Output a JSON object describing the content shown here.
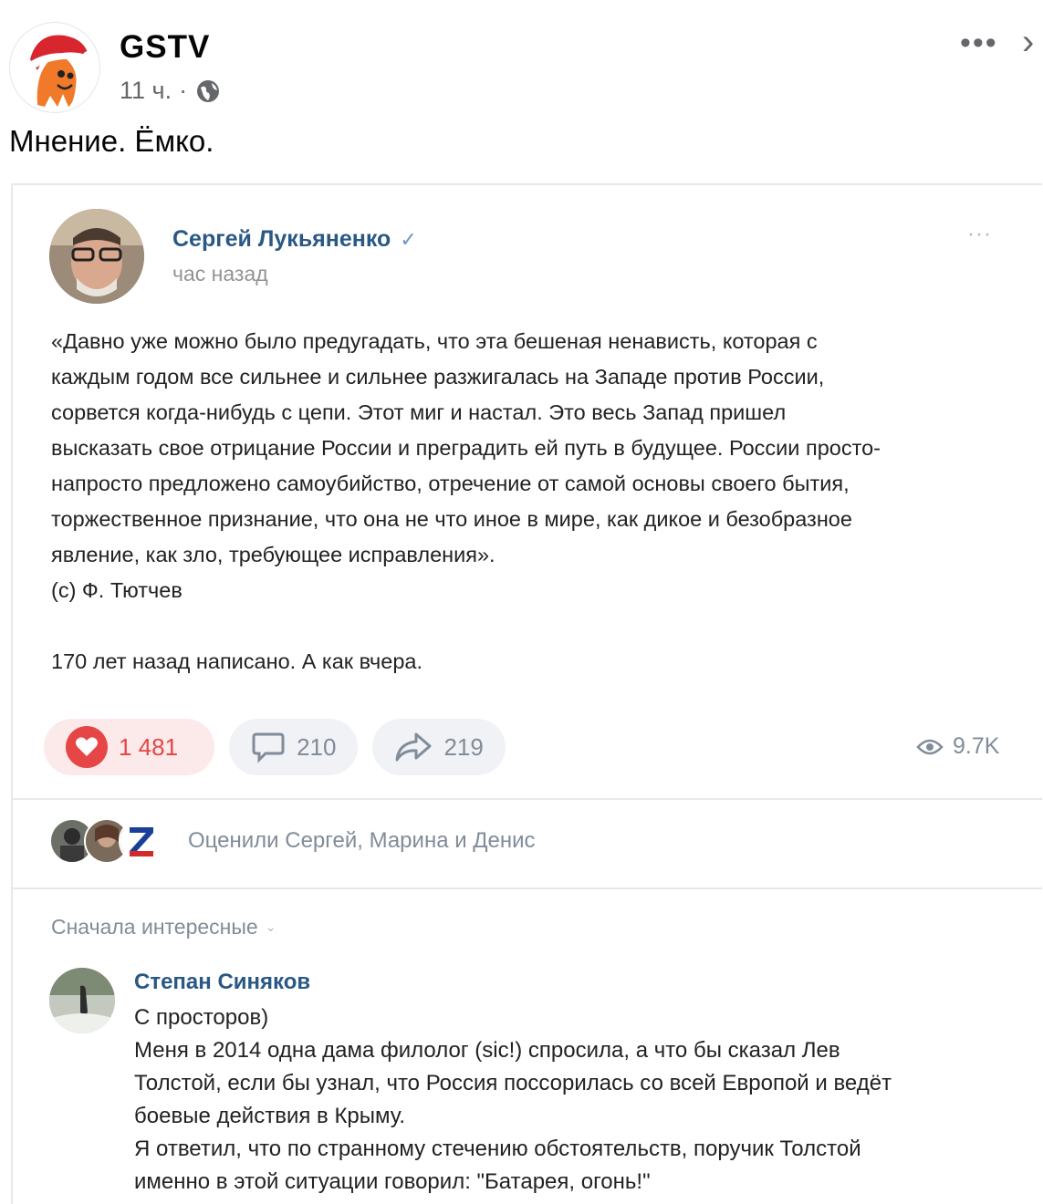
{
  "fb_post": {
    "page_name": "GSTV",
    "time": "11 ч.",
    "dot": "·",
    "caption": "Мнение. Ёмко."
  },
  "vk_post": {
    "author": "Сергей Лукьяненко",
    "verified_mark": "✓",
    "time": "час назад",
    "more": "···",
    "quote_lines": [
      "«Давно уже можно было предугадать, что эта бешеная ненависть, которая с",
      "каждым годом все сильнее и сильнее разжигалась на Западе против России,",
      "сорвется когда-нибудь с цепи. Этот миг и настал. Это весь Запад пришел",
      "высказать свое отрицание России и преградить ей путь в будущее. России просто-",
      "напросто предложено самоубийство, отречение от самой основы своего бытия,",
      "торжественное признание, что она не что иное в мире, как дикое и безобразное",
      "явление, как зло, требующее исправления».",
      "(с) Ф. Тютчев"
    ],
    "footer_line": "170 лет назад написано. А как вчера.",
    "likes": "1 481",
    "comments": "210",
    "shares": "219",
    "views": "9.7K",
    "liked_by": "Оценили Сергей, Марина и Денис",
    "sort_label": "Сначала интересные",
    "comment": {
      "author": "Степан Синяков",
      "lines": [
        "С просторов)",
        "Меня в 2014 одна дама филолог (sic!) спросила, а что бы сказал Лев",
        "Толстой, если бы узнал, что Россия поссорилась со всей Европой и ведёт",
        "боевые действия в Крыму.",
        "Я ответил, что по странному стечению обстоятельств, поручик Толстой",
        "именно в этой ситуации говорил: \"Батарея, огонь!\""
      ]
    }
  },
  "colors": {
    "vk_link": "#2a5885",
    "vk_like_red": "#e64646",
    "vk_muted": "#818c99",
    "fb_muted": "#65676b"
  }
}
